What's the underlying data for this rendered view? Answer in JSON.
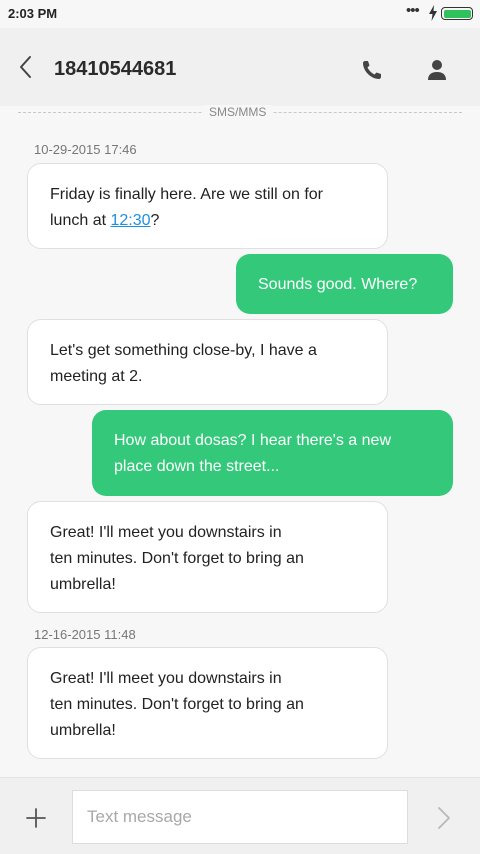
{
  "status_bar": {
    "time": "2:03 PM",
    "dots": "•••"
  },
  "header": {
    "contact": "18410544681"
  },
  "channel": {
    "label": "SMS/MMS"
  },
  "thread": {
    "timestamp_1": "10-29-2015 17:46",
    "msg_1": {
      "before": "Friday is finally here. Are we still on for lunch at ",
      "link": "12:30",
      "after": "?"
    },
    "msg_2": "Sounds good. Where?",
    "msg_3": "Let's get something close-by, I have a meeting at 2.",
    "msg_4": "How about dosas? I hear there's a new place down the street...",
    "msg_5": "Great! I'll meet you downstairs in ten minutes. Don't forget to bring an umbrella!",
    "timestamp_2": "12-16-2015 11:48",
    "msg_6": "Great! I'll meet you downstairs in ten minutes. Don't forget to bring an umbrella!"
  },
  "composer": {
    "placeholder": "Text message"
  },
  "icons": {
    "back": "chevron-left-icon",
    "call": "phone-icon",
    "contact": "person-icon",
    "add": "plus-icon",
    "send": "chevron-right-icon",
    "battery": "battery-icon",
    "charging": "bolt-icon"
  },
  "colors": {
    "outgoing_bubble": "#34c97a",
    "incoming_bubble": "#ffffff",
    "link": "#1e8fe0",
    "battery": "#2ec15c"
  }
}
